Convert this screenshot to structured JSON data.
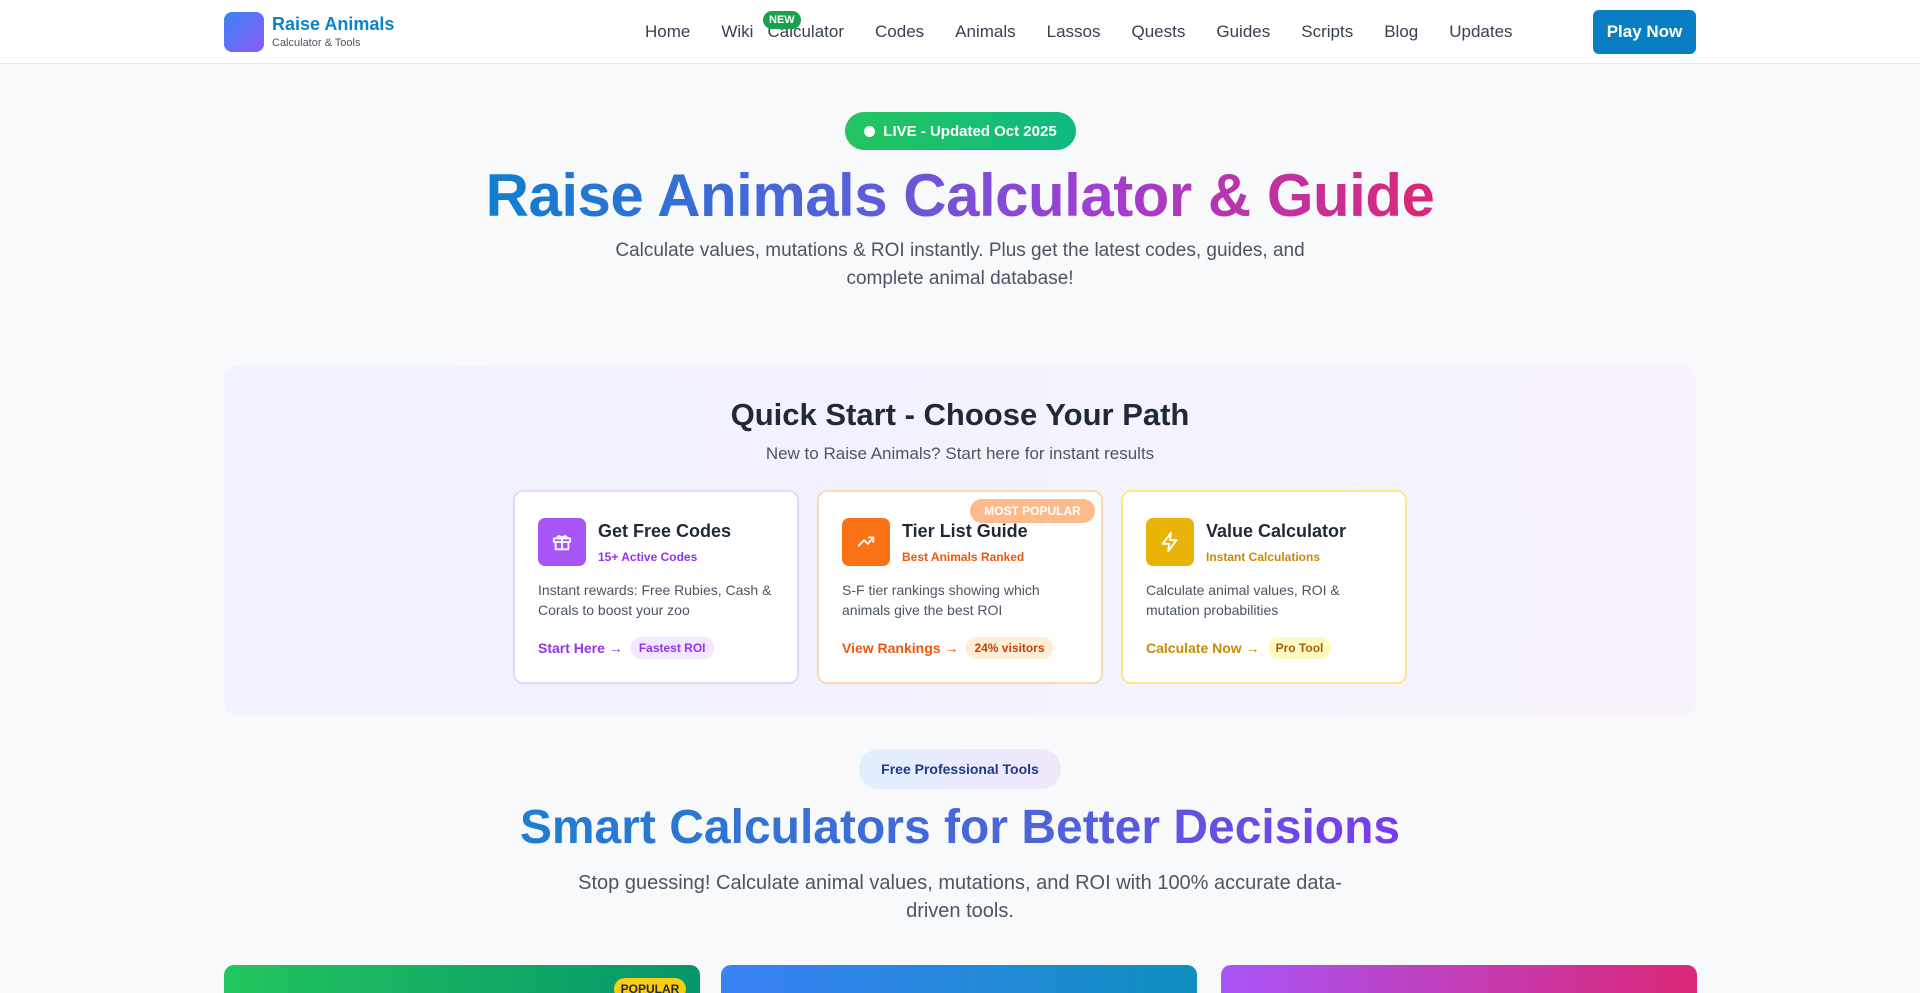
{
  "brand": {
    "title": "Raise Animals",
    "subtitle": "Calculator & Tools"
  },
  "nav": {
    "items": [
      "Home",
      "Wiki",
      "Calculator",
      "Codes",
      "Animals",
      "Lassos",
      "Quests",
      "Guides",
      "Scripts",
      "Blog",
      "Updates"
    ],
    "new_badge": "NEW",
    "play_button": "Play Now"
  },
  "hero": {
    "live_badge": "LIVE - Updated Oct 2025",
    "title": "Raise Animals Calculator & Guide",
    "subtitle": "Calculate values, mutations & ROI instantly. Plus get the latest codes, guides, and complete animal database!"
  },
  "quick_start": {
    "title": "Quick Start - Choose Your Path",
    "subtitle": "New to Raise Animals? Start here for instant results",
    "popular_ribbon": "MOST POPULAR",
    "cards": [
      {
        "icon": "gift-icon",
        "title": "Get Free Codes",
        "tag": "15+ Active Codes",
        "desc": "Instant rewards: Free Rubies, Cash & Corals to boost your zoo",
        "link": "Start Here →",
        "pill": "Fastest ROI",
        "color": "#a855f7"
      },
      {
        "icon": "trending-up-icon",
        "title": "Tier List Guide",
        "tag": "Best Animals Ranked",
        "desc": "S-F tier rankings showing which animals give the best ROI",
        "link": "View Rankings →",
        "pill": "24% visitors",
        "color": "#f97316"
      },
      {
        "icon": "lightning-icon",
        "title": "Value Calculator",
        "tag": "Instant Calculations",
        "desc": "Calculate animal values, ROI & mutation probabilities",
        "link": "Calculate Now →",
        "pill": "Pro Tool",
        "color": "#eab308"
      }
    ]
  },
  "tools": {
    "badge": "Free Professional Tools",
    "title": "Smart Calculators for Better Decisions",
    "subtitle": "Stop guessing! Calculate animal values, mutations, and ROI with 100% accurate data-driven tools.",
    "popular_badge": "POPULAR"
  },
  "colors": {
    "accent": "#0a7ec2",
    "live_green": "#22c55e"
  }
}
